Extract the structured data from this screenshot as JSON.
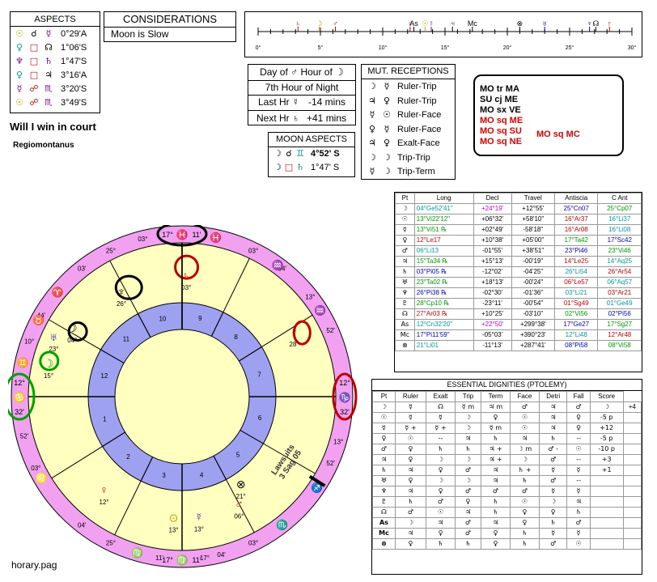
{
  "aspects": {
    "title": "ASPECTS",
    "rows": [
      {
        "p1": "☉",
        "p1c": "#c8a000",
        "asp": "☌",
        "aspc": "#000",
        "p2": "☿",
        "p2c": "#7a00a0",
        "val": "0°29'A"
      },
      {
        "p1": "♀",
        "p1c": "#00a0a0",
        "asp": "□",
        "aspc": "#d00",
        "p2": "☊",
        "p2c": "#000",
        "val": "1°06'S"
      },
      {
        "p1": "♆",
        "p1c": "#7a00a0",
        "asp": "□",
        "aspc": "#d00",
        "p2": "♄",
        "p2c": "#7a00a0",
        "val": "1°47'S"
      },
      {
        "p1": "♀",
        "p1c": "#00a0a0",
        "asp": "□",
        "aspc": "#d00",
        "p2": "♃",
        "p2c": "#000",
        "val": "3°16'A"
      },
      {
        "p1": "☿",
        "p1c": "#7a00a0",
        "asp": "☍",
        "aspc": "#d00",
        "p2": "♏",
        "p2c": "#7a00a0",
        "val": "3°20'S"
      },
      {
        "p1": "☉",
        "p1c": "#c8a000",
        "asp": "☍",
        "aspc": "#d00",
        "p2": "♏",
        "p2c": "#7a00a0",
        "val": "3°49'S"
      }
    ]
  },
  "considerations": {
    "title": "CONSIDERATIONS",
    "text": "Moon is Slow"
  },
  "question": "Will I win in court",
  "house_system": "Regiomontanus",
  "ruler_scale": {
    "ticks": [
      "0°",
      "5°",
      "10°",
      "15°",
      "20°",
      "25°",
      "30°"
    ]
  },
  "hour_box": {
    "line1": "Day of ♂ Hour of ☽",
    "line2": "7th Hour of Night",
    "last_label": "Last Hr ☿",
    "last_val": "-14 mins",
    "next_label": "Next Hr ♄",
    "next_val": "+41 mins"
  },
  "moon_aspects": {
    "title": "MOON ASPECTS",
    "rows": [
      {
        "a": "☽",
        "b": "☌",
        "c": "♊",
        "val": "4°52' S"
      },
      {
        "a": "☽",
        "b": "□",
        "c": "♄",
        "val": "1°47' S"
      }
    ]
  },
  "mut_receptions": {
    "title": "MUT. RECEPTIONS",
    "rows": [
      {
        "a": "☽",
        "b": "☿",
        "t": "Ruler-Trip"
      },
      {
        "a": "♃",
        "b": "♀",
        "t": "Ruler-Trip"
      },
      {
        "a": "☿",
        "b": "☉",
        "t": "Ruler-Face"
      },
      {
        "a": "♀",
        "b": "☿",
        "t": "Ruler-Face"
      },
      {
        "a": "♃",
        "b": "♀",
        "t": "Exalt-Face"
      },
      {
        "a": "☽",
        "b": "☽",
        "t": "Trip-Trip"
      },
      {
        "a": "☿",
        "b": "☽",
        "t": "Trip-Term"
      }
    ]
  },
  "notes": {
    "black": [
      "MO tr MA",
      "SU cj ME",
      "MO sx VE"
    ],
    "red": [
      "MO sq ME",
      "MO sq SU",
      "MO sq NE"
    ],
    "extra": "MO sq MC"
  },
  "positions": {
    "headers": [
      "Pt",
      "Long",
      "Decl",
      "Travel",
      "Antiscia",
      "C Ant"
    ],
    "rows": [
      {
        "pt": "☽",
        "long": "04°Ge52'41\"",
        "decl": "+24°19'",
        "travel": "+12°55'",
        "ant": "25°Cn07",
        "cant": "25°Cp07",
        "lc": "#00a0a0"
      },
      {
        "pt": "☉",
        "long": "13°Vi22'12\"",
        "decl": "+06°32'",
        "travel": "+58'10\"",
        "ant": "16°Ar37",
        "cant": "16°Li37",
        "lc": "#00a000"
      },
      {
        "pt": "☿",
        "long": "13°Vi51 ℞",
        "decl": "+02°49'",
        "travel": "-58'18\"",
        "ant": "16°Ar08",
        "cant": "16°Li08",
        "lc": "#00a000"
      },
      {
        "pt": "♀",
        "long": "12°Le17",
        "decl": "+10°38'",
        "travel": "+05'00\"",
        "ant": "17°Ta42",
        "cant": "17°Sc42",
        "lc": "#d00000"
      },
      {
        "pt": "♂",
        "long": "06°Li13",
        "decl": "-01°55'",
        "travel": "+38'51\"",
        "ant": "23°Pi46",
        "cant": "23°Vi46",
        "lc": "#00a0a0"
      },
      {
        "pt": "♃",
        "long": "15°Ta34 ℞",
        "decl": "+15°13'",
        "travel": "-00'19\"",
        "ant": "14°Le25",
        "cant": "14°Aq25",
        "lc": "#00a000"
      },
      {
        "pt": "♄",
        "long": "03°Pi05 ℞",
        "decl": "-12°02'",
        "travel": "-04'25\"",
        "ant": "26°Li54",
        "cant": "26°Ar54",
        "lc": "#0000d0"
      },
      {
        "pt": "♅",
        "long": "23°Ta02 ℞",
        "decl": "+18°13'",
        "travel": "-00'24\"",
        "ant": "06°Le57",
        "cant": "06°Aq57",
        "lc": "#00a000"
      },
      {
        "pt": "♆",
        "long": "26°Pi38 ℞",
        "decl": "-02°30'",
        "travel": "-01'36\"",
        "ant": "03°Li21",
        "cant": "03°Ar21",
        "lc": "#0000d0"
      },
      {
        "pt": "♇",
        "long": "28°Cp10 ℞",
        "decl": "-23°11'",
        "travel": "-00'54\"",
        "ant": "01°Sg49",
        "cant": "01°Ge49",
        "lc": "#00a000"
      },
      {
        "pt": "☊",
        "long": "27°Ar03 ℞",
        "decl": "+10°25'",
        "travel": "-03'10\"",
        "ant": "02°Vi56",
        "cant": "02°Pi56",
        "lc": "#d00000"
      },
      {
        "pt": "As",
        "long": "12°Cn32'20\"",
        "decl": "+22°50'",
        "travel": "+299°38'",
        "ant": "17°Ge27",
        "cant": "17°Sg27",
        "lc": "#00a0a0"
      },
      {
        "pt": "Mc",
        "long": "17°Pi11'59\"",
        "decl": "-05°03'",
        "travel": "+390°23'",
        "ant": "12°Li48",
        "cant": "12°Ar48",
        "lc": "#0000d0"
      },
      {
        "pt": "⊗",
        "long": "21°Li01",
        "decl": "-11°13'",
        "travel": "+287°41'",
        "ant": "08°Pi58",
        "cant": "08°Vi58",
        "lc": "#00a0a0"
      }
    ]
  },
  "dignities": {
    "title": "ESSENTIAL DIGNITIES (PTOLEMY)",
    "headers": [
      "Pt",
      "Ruler",
      "Exalt",
      "Trip",
      "Term",
      "Face",
      "Detri",
      "Fall",
      "Score"
    ],
    "rows": [
      {
        "pt": "☽",
        "c": [
          "☿",
          "☊",
          "☿ m",
          "♃ m",
          "♂",
          "♃",
          "♂",
          "☽"
        ],
        "s": "+4"
      },
      {
        "pt": "☉",
        "c": [
          "☿",
          "☿",
          "☽",
          "♀",
          "☉",
          "♃",
          "♀",
          "-5 p"
        ]
      },
      {
        "pt": "☿",
        "c": [
          "☿ +",
          "☿ +",
          "☽",
          "☿ m",
          "☉",
          "♃",
          "♀",
          "+12"
        ]
      },
      {
        "pt": "♀",
        "c": [
          "☉",
          "--",
          "♃",
          "♄",
          "♃",
          "♄",
          "--",
          "-5 p"
        ]
      },
      {
        "pt": "♂",
        "c": [
          "♀",
          "♄",
          "♄",
          "♃ +",
          "☽ m",
          "♂ -",
          "☉",
          "-10 p"
        ]
      },
      {
        "pt": "♃",
        "c": [
          "♀",
          "☽",
          "☽",
          "♃ +",
          "☽",
          "♂",
          "--",
          "+3"
        ]
      },
      {
        "pt": "♄",
        "c": [
          "♃",
          "♀",
          "♂",
          "♃",
          "♄ +",
          "☿",
          "☿",
          "+1"
        ]
      },
      {
        "pt": "♅",
        "c": [
          "♀",
          "☽",
          "☽",
          "♃",
          "♄",
          "♂",
          "--",
          ""
        ]
      },
      {
        "pt": "♆",
        "c": [
          "♃",
          "♀",
          "♂",
          "♂",
          "♂",
          "☿",
          "☿",
          ""
        ]
      },
      {
        "pt": "♇",
        "c": [
          "♄",
          "♂",
          "♀",
          "♄",
          "☉",
          "☽",
          "♃",
          ""
        ]
      },
      {
        "pt": "☊",
        "c": [
          "♂",
          "☉",
          "♃",
          "♄",
          "♀",
          "♀",
          "♄",
          ""
        ]
      },
      {
        "pt": "As",
        "c": [
          "☽",
          "♃",
          "♂",
          "♃",
          "♀",
          "♄",
          "♂",
          ""
        ]
      },
      {
        "pt": "Mc",
        "c": [
          "♃",
          "♀",
          "♂",
          "♀",
          "♄",
          "☿",
          "☿",
          ""
        ]
      },
      {
        "pt": "⊗",
        "c": [
          "♀",
          "♄",
          "♄",
          "♀",
          "♄",
          "♂",
          "☉",
          ""
        ]
      }
    ]
  },
  "chart": {
    "mc": {
      "deg": "17°",
      "sign": "♓",
      "min": "11'"
    },
    "ic": {
      "deg": "17°",
      "sign": "♍",
      "min": "11'"
    },
    "asc": {
      "deg": "12°",
      "sign": "♋",
      "min": "32'"
    },
    "dsc": {
      "deg": "12°",
      "sign": "♑",
      "min": "32'"
    },
    "annotation": "Lawsuits\n3 Sag 05",
    "footer": "horary.pag"
  }
}
